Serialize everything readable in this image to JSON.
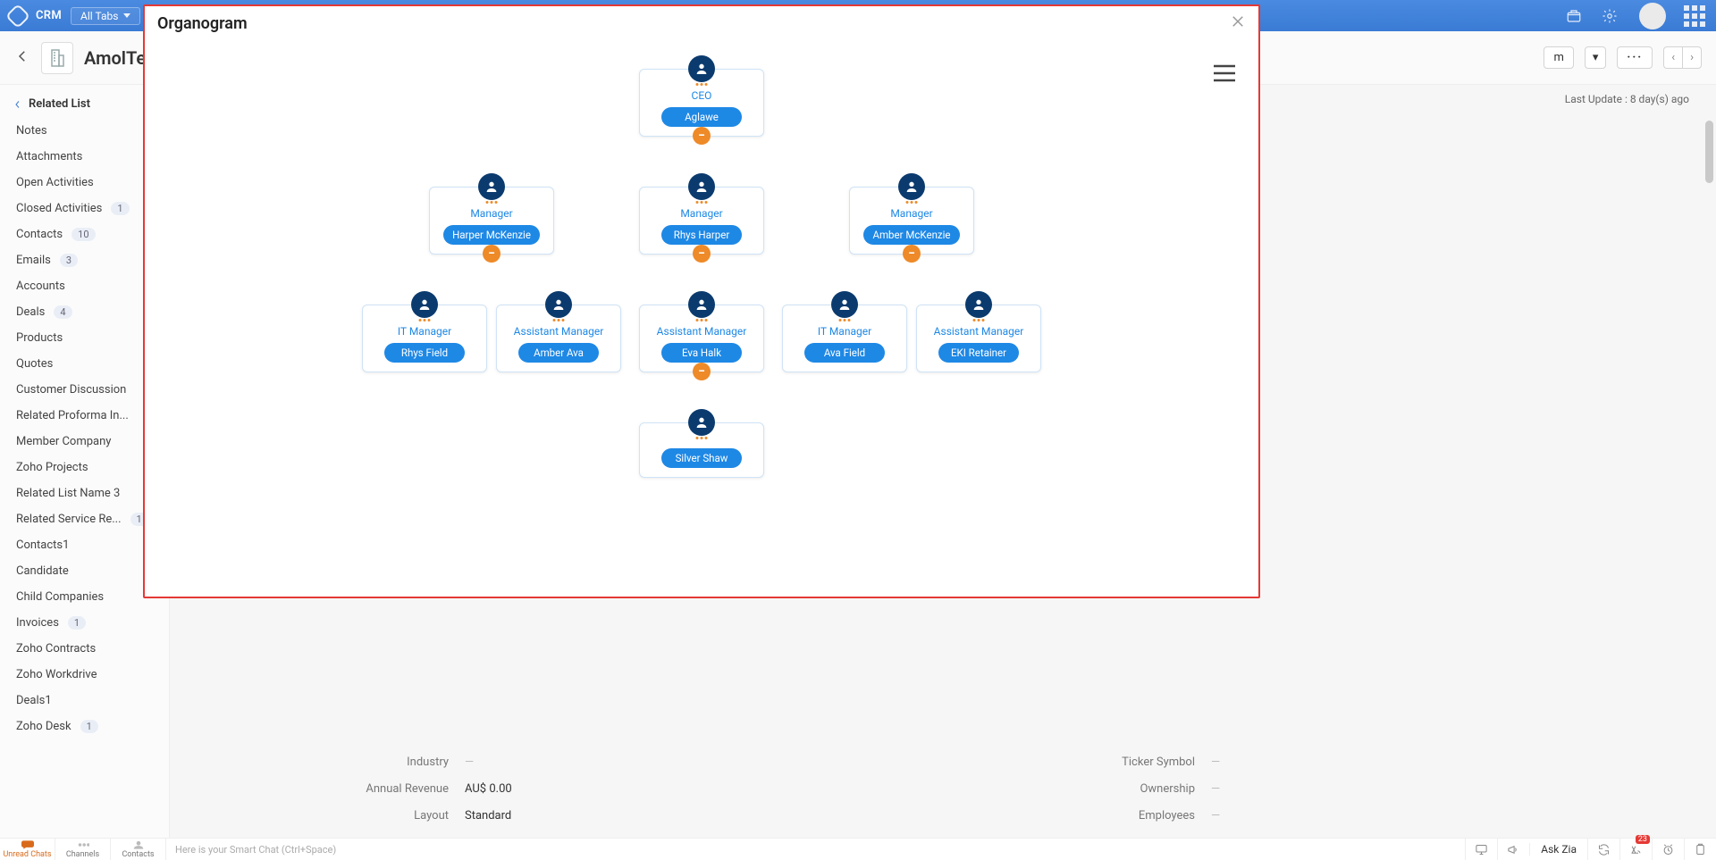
{
  "topbar": {
    "brand": "CRM",
    "tabs_label": "All Tabs"
  },
  "page": {
    "account_name": "AmolTestin",
    "truncated_button": "m",
    "last_update": "Last Update : 8 day(s) ago"
  },
  "sidebar": {
    "header": "Related List",
    "items": [
      {
        "label": "Notes"
      },
      {
        "label": "Attachments"
      },
      {
        "label": "Open Activities"
      },
      {
        "label": "Closed Activities",
        "badge": "1"
      },
      {
        "label": "Contacts",
        "badge": "10"
      },
      {
        "label": "Emails",
        "badge": "3"
      },
      {
        "label": "Accounts"
      },
      {
        "label": "Deals",
        "badge": "4"
      },
      {
        "label": "Products"
      },
      {
        "label": "Quotes"
      },
      {
        "label": "Customer Discussion"
      },
      {
        "label": "Related Proforma In..."
      },
      {
        "label": "Member Company"
      },
      {
        "label": "Zoho Projects"
      },
      {
        "label": "Related List Name 3"
      },
      {
        "label": "Related Service Re...",
        "badge": "1"
      },
      {
        "label": "Contacts1"
      },
      {
        "label": "Candidate"
      },
      {
        "label": "Child Companies"
      },
      {
        "label": "Invoices",
        "badge": "1"
      },
      {
        "label": "Zoho Contracts"
      },
      {
        "label": "Zoho Workdrive"
      },
      {
        "label": "Deals1"
      },
      {
        "label": "Zoho Desk",
        "badge": "1"
      }
    ]
  },
  "details": {
    "rows": [
      {
        "l_label": "Industry",
        "l_value": "—",
        "r_label": "Ticker Symbol",
        "r_value": "—"
      },
      {
        "l_label": "Annual Revenue",
        "l_value": "AU$ 0.00",
        "r_label": "Ownership",
        "r_value": "—"
      },
      {
        "l_label": "Layout",
        "l_value": "Standard",
        "r_label": "Employees",
        "r_value": "—"
      }
    ]
  },
  "modal": {
    "title": "Organogram"
  },
  "org": {
    "nodes": {
      "ceo": {
        "role": "CEO",
        "name": "Aglawe"
      },
      "m1": {
        "role": "Manager",
        "name": "Harper McKenzie"
      },
      "m2": {
        "role": "Manager",
        "name": "Rhys Harper"
      },
      "m3": {
        "role": "Manager",
        "name": "Amber McKenzie"
      },
      "it1": {
        "role": "IT Manager",
        "name": "Rhys Field"
      },
      "am1": {
        "role": "Assistant Manager",
        "name": "Amber Ava"
      },
      "am2": {
        "role": "Assistant Manager",
        "name": "Eva Halk"
      },
      "it2": {
        "role": "IT Manager",
        "name": "Ava Field"
      },
      "am3": {
        "role": "Assistant Manager",
        "name": "EKI Retainer"
      },
      "leaf": {
        "role": "",
        "name": "Silver Shaw"
      }
    }
  },
  "bottombar": {
    "tab1": "Unread Chats",
    "tab2": "Channels",
    "tab3": "Contacts",
    "placeholder": "Here is your Smart Chat (Ctrl+Space)",
    "ask": "Ask Zia",
    "badge_count": "23"
  },
  "chart_data": {
    "type": "tree",
    "title": "Organogram",
    "root": {
      "role": "CEO",
      "name": "Aglawe",
      "children": [
        {
          "role": "Manager",
          "name": "Harper McKenzie",
          "children": [
            {
              "role": "IT Manager",
              "name": "Rhys Field"
            },
            {
              "role": "Assistant Manager",
              "name": "Amber Ava"
            }
          ]
        },
        {
          "role": "Manager",
          "name": "Rhys Harper",
          "children": [
            {
              "role": "Assistant Manager",
              "name": "Eva Halk",
              "children": [
                {
                  "role": "",
                  "name": "Silver Shaw"
                }
              ]
            }
          ]
        },
        {
          "role": "Manager",
          "name": "Amber McKenzie",
          "children": [
            {
              "role": "IT Manager",
              "name": "Ava Field"
            },
            {
              "role": "Assistant Manager",
              "name": "EKI Retainer"
            }
          ]
        }
      ]
    }
  }
}
